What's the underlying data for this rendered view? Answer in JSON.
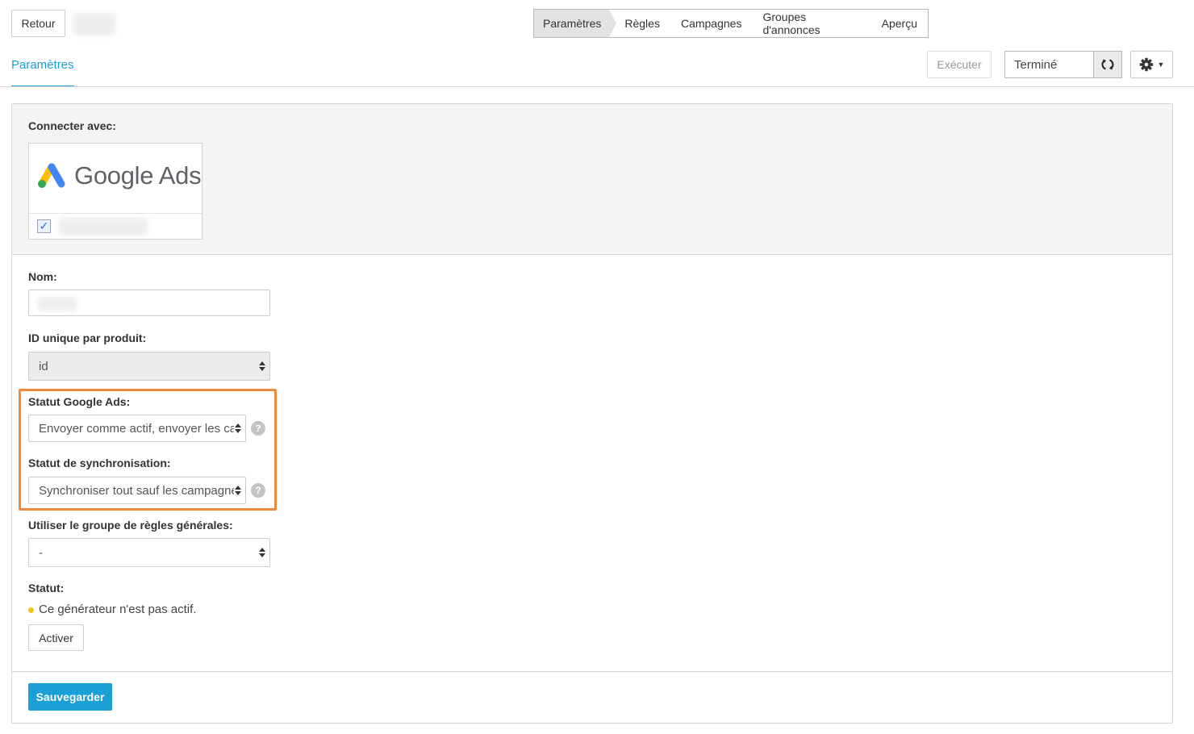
{
  "header": {
    "back_label": "Retour",
    "steps": [
      "Paramètres",
      "Règles",
      "Campagnes",
      "Groupes d'annonces",
      "Aperçu"
    ],
    "active_tab": "Paramètres",
    "run_label": "Exécuter",
    "run_status": "Terminé",
    "refresh_icon": "refresh-icon",
    "settings_icon": "gear-icon"
  },
  "connect": {
    "label": "Connecter avec:",
    "service": "Google Ads",
    "checked": true
  },
  "form": {
    "name_label": "Nom:",
    "unique_id_label": "ID unique par produit:",
    "unique_id_value": "id",
    "ads_status_label": "Statut Google Ads:",
    "ads_status_value": "Envoyer comme actif, envoyer les campagnes",
    "sync_status_label": "Statut de synchronisation:",
    "sync_status_value": "Synchroniser tout sauf les campagnes",
    "rules_group_label": "Utiliser le groupe de règles générales:",
    "rules_group_value": "-",
    "status_label": "Statut:",
    "status_text": "Ce générateur n'est pas actif.",
    "activate_label": "Activer",
    "help_glyph": "?"
  },
  "footer": {
    "save_label": "Sauvegarder"
  },
  "colors": {
    "accent": "#1a9fd6",
    "highlight": "#ee8a3d",
    "inactive_dot": "#f0c419"
  }
}
